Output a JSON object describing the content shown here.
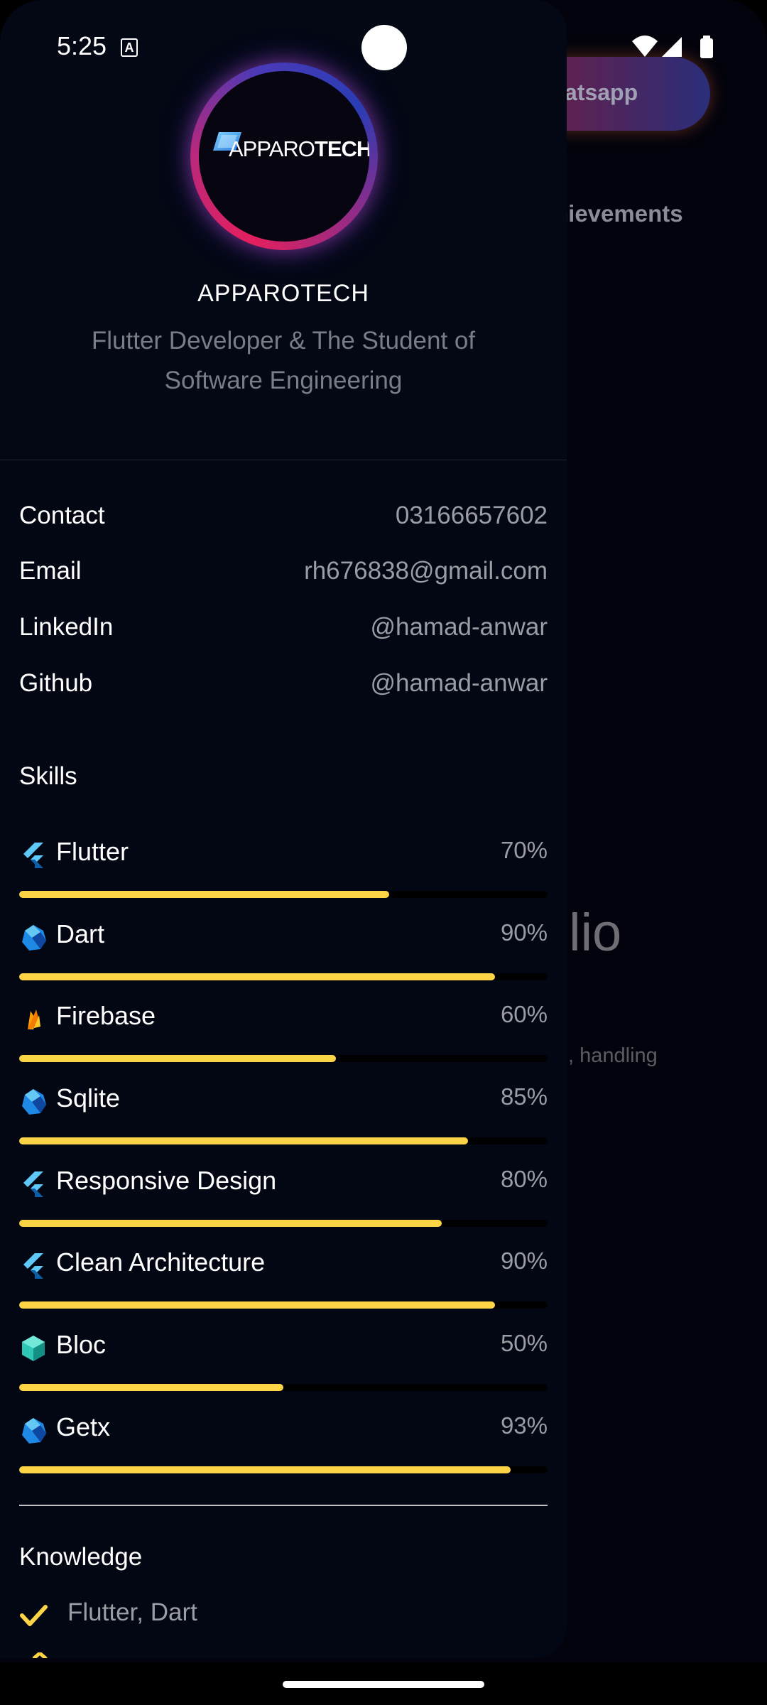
{
  "status_bar": {
    "time": "5:25",
    "notification_glyph": "A"
  },
  "background": {
    "button_label": "atsapp",
    "tab_label": "nievements",
    "big_text": "olio",
    "sub_text": ", handling"
  },
  "profile": {
    "logo": "APPAROTECH",
    "name": "APPAROTECH",
    "bio": "Flutter Developer & The Student of Software Engineering"
  },
  "info": [
    {
      "label": "Contact",
      "value": "03166657602"
    },
    {
      "label": "Email",
      "value": "rh676838@gmail.com"
    },
    {
      "label": "LinkedIn",
      "value": "@hamad-anwar"
    },
    {
      "label": "Github",
      "value": "@hamad-anwar"
    }
  ],
  "skills_title": "Skills",
  "skills": [
    {
      "name": "Flutter",
      "percent_label": "70%",
      "level": 0.7,
      "icon": "flutter-icon"
    },
    {
      "name": "Dart",
      "percent_label": "90%",
      "level": 0.9,
      "icon": "dart-icon"
    },
    {
      "name": "Firebase",
      "percent_label": "60%",
      "level": 0.6,
      "icon": "firebase-icon"
    },
    {
      "name": "Sqlite",
      "percent_label": "85%",
      "level": 0.85,
      "icon": "dart-icon"
    },
    {
      "name": "Responsive Design",
      "percent_label": "80%",
      "level": 0.8,
      "icon": "flutter-icon"
    },
    {
      "name": "Clean Architecture",
      "percent_label": "90%",
      "level": 0.9,
      "icon": "flutter-icon"
    },
    {
      "name": "Bloc",
      "percent_label": "50%",
      "level": 0.5,
      "icon": "bloc-icon"
    },
    {
      "name": "Getx",
      "percent_label": "93%",
      "level": 0.93,
      "icon": "dart-icon"
    }
  ],
  "knowledge_title": "Knowledge",
  "knowledge": [
    {
      "text": "Flutter, Dart"
    }
  ],
  "colors": {
    "accent_bar": "#fdd445",
    "drawer_bg": "#030613",
    "check": "#fdd445"
  }
}
